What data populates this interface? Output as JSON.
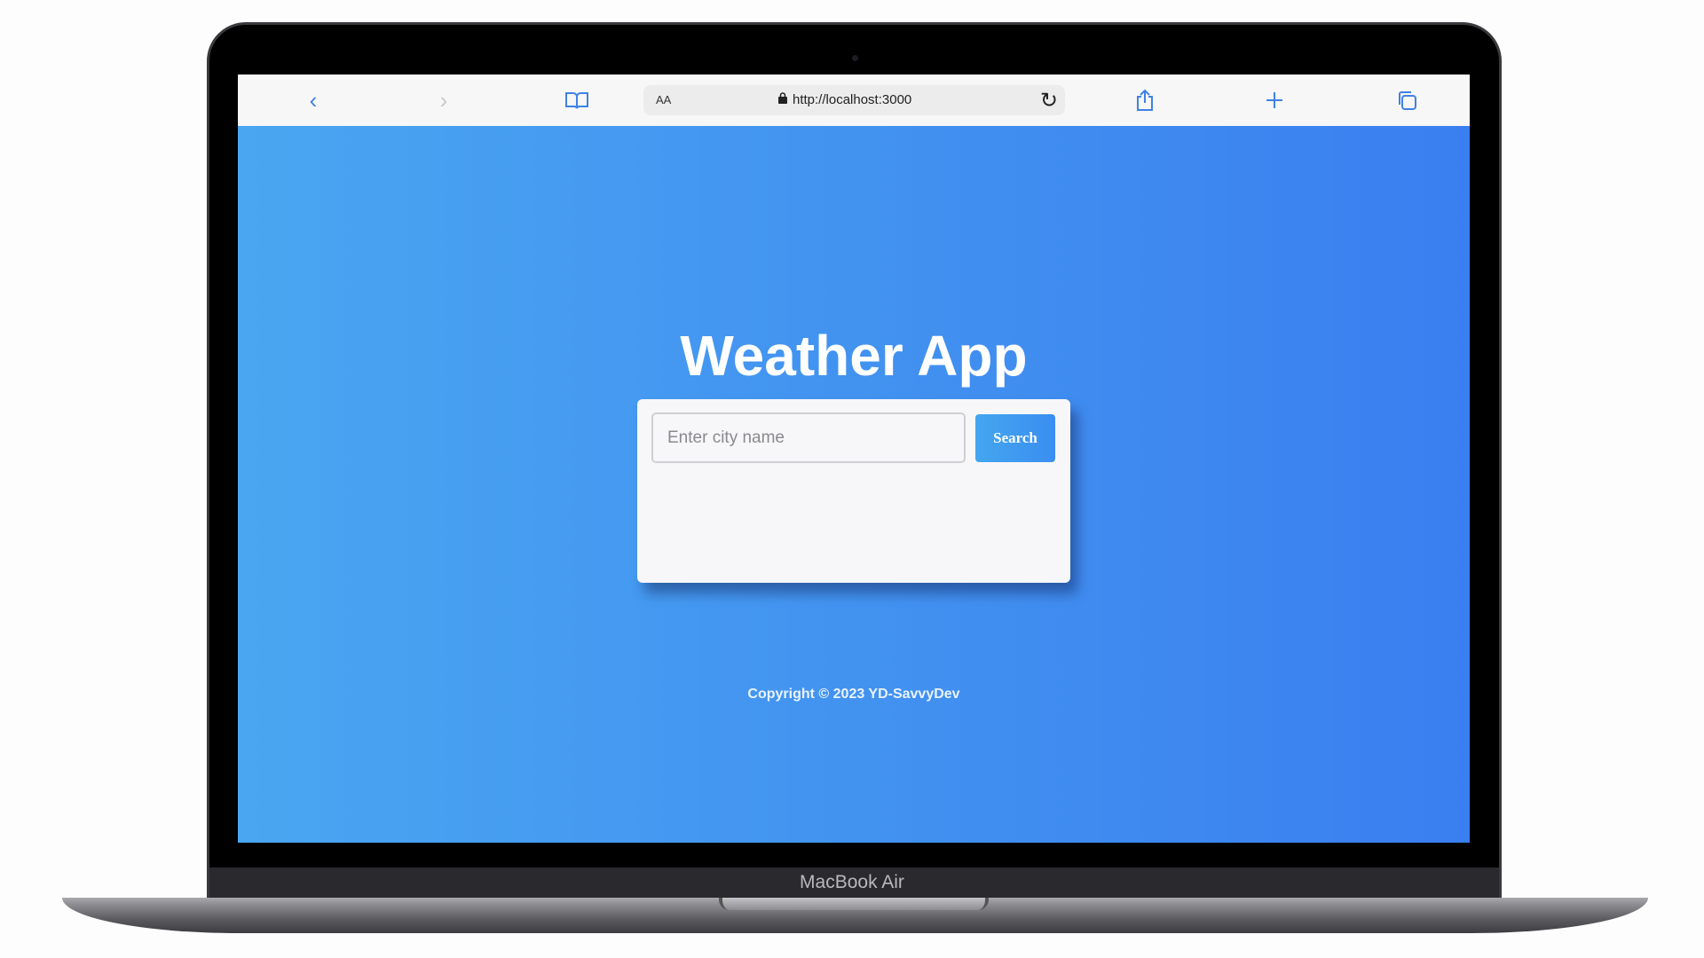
{
  "device": {
    "label": "MacBook Air"
  },
  "browser": {
    "reader_label": "AA",
    "url": "http://localhost:3000",
    "icons": [
      "back-icon",
      "forward-icon",
      "bookmarks-icon",
      "lock-icon",
      "reload-icon",
      "share-icon",
      "new-tab-icon",
      "tabs-icon"
    ]
  },
  "app": {
    "title": "Weather App",
    "search_placeholder": "Enter city name",
    "search_value": "",
    "search_button": "Search",
    "footer": "Copyright © 2023 YD-SavvyDev"
  },
  "colors": {
    "accent": "#3f82e6",
    "gradient_start": "#4aa6f1",
    "gradient_end": "#3a7ff0"
  }
}
